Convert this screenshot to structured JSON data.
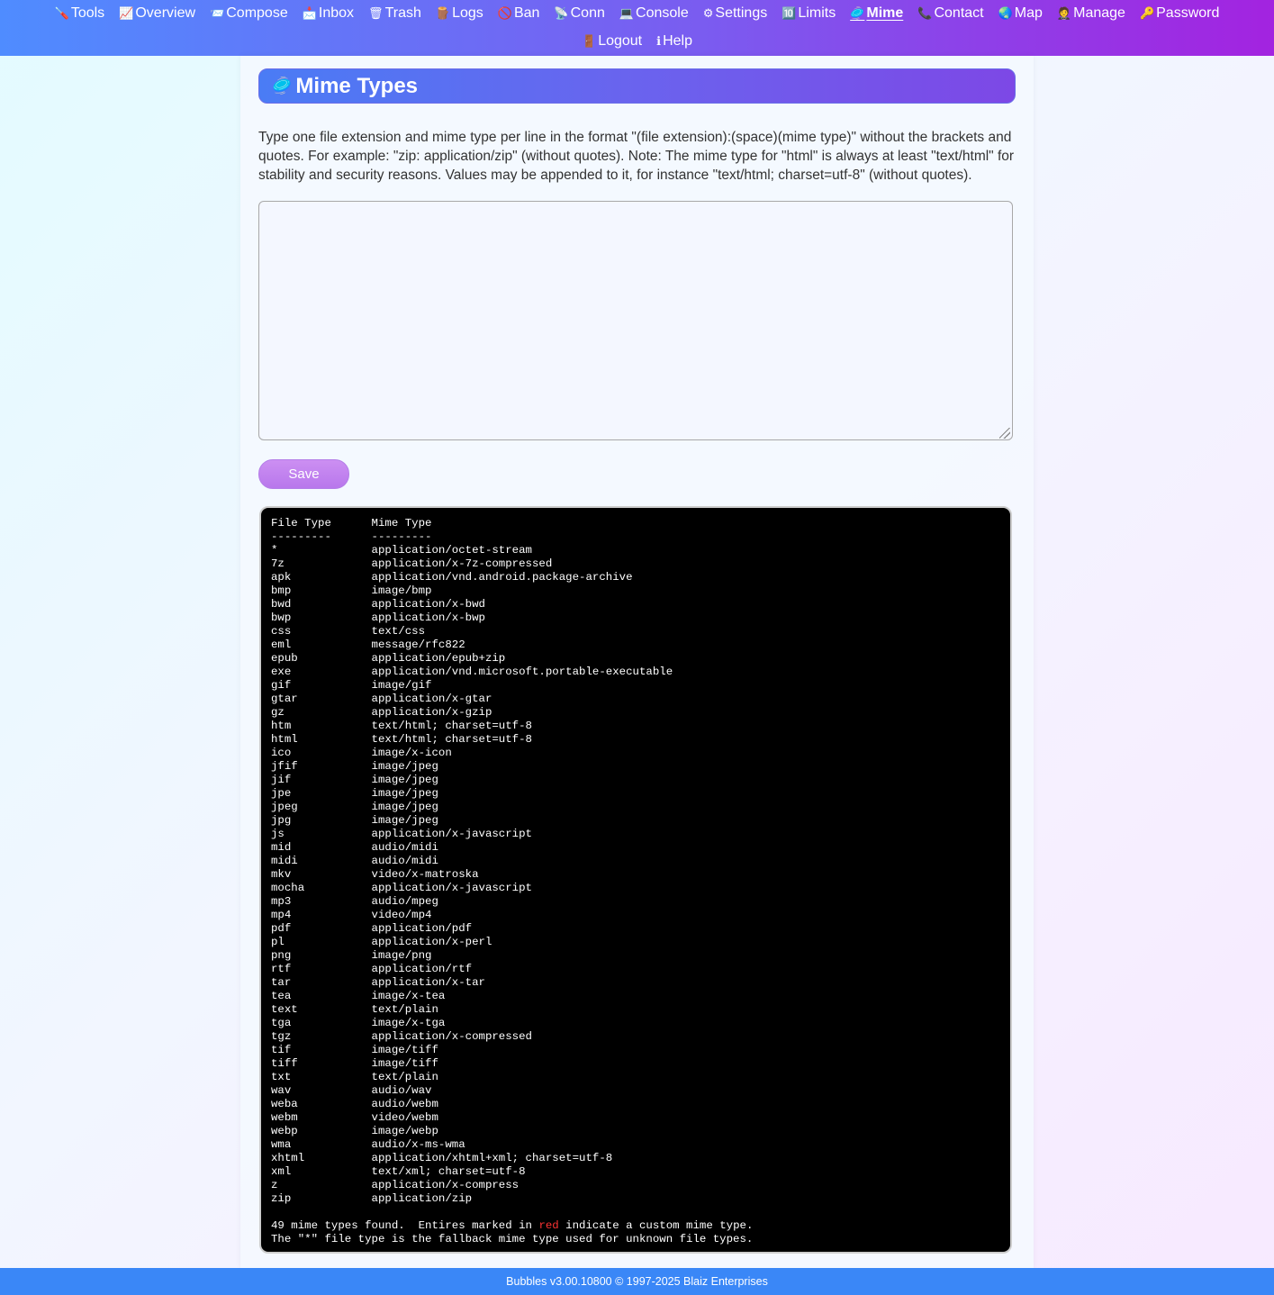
{
  "nav": {
    "row1": [
      {
        "icon": "🪛",
        "label": "Tools"
      },
      {
        "icon": "📈",
        "label": "Overview"
      },
      {
        "icon": "📨",
        "label": "Compose"
      },
      {
        "icon": "📩",
        "label": "Inbox"
      },
      {
        "icon": "🗑",
        "label": "Trash"
      },
      {
        "icon": "🪵",
        "label": "Logs"
      },
      {
        "icon": "🚫",
        "label": "Ban"
      },
      {
        "icon": "📡",
        "label": "Conn"
      },
      {
        "icon": "💻",
        "label": "Console"
      },
      {
        "icon": "⚙",
        "label": "Settings"
      },
      {
        "icon": "🔟",
        "label": "Limits"
      },
      {
        "icon": "🥏",
        "label": "Mime"
      },
      {
        "icon": "📞",
        "label": "Contact"
      },
      {
        "icon": "🌏",
        "label": "Map"
      },
      {
        "icon": "🤵",
        "label": "Manage"
      },
      {
        "icon": "🔑",
        "label": "Password"
      }
    ],
    "row2": [
      {
        "icon": "🚪",
        "label": "Logout"
      },
      {
        "icon": "ℹ",
        "label": "Help"
      }
    ],
    "active": "Mime"
  },
  "page": {
    "title_icon": "🥏",
    "title": "Mime Types",
    "instructions": "Type one file extension and mime type per line in the format \"(file extension):(space)(mime type)\" without the brackets and quotes. For example: \"zip: application/zip\" (without quotes). Note: The mime type for \"html\" is always at least \"text/html\" for stability and security reasons. Values may be appended to it, for instance \"text/html; charset=utf-8\" (without quotes).",
    "textarea_value": "",
    "save_label": "Save"
  },
  "console": {
    "header_file": "File Type",
    "header_mime": "Mime Type",
    "separator": "---------",
    "rows": [
      [
        "*",
        "application/octet-stream"
      ],
      [
        "7z",
        "application/x-7z-compressed"
      ],
      [
        "apk",
        "application/vnd.android.package-archive"
      ],
      [
        "bmp",
        "image/bmp"
      ],
      [
        "bwd",
        "application/x-bwd"
      ],
      [
        "bwp",
        "application/x-bwp"
      ],
      [
        "css",
        "text/css"
      ],
      [
        "eml",
        "message/rfc822"
      ],
      [
        "epub",
        "application/epub+zip"
      ],
      [
        "exe",
        "application/vnd.microsoft.portable-executable"
      ],
      [
        "gif",
        "image/gif"
      ],
      [
        "gtar",
        "application/x-gtar"
      ],
      [
        "gz",
        "application/x-gzip"
      ],
      [
        "htm",
        "text/html; charset=utf-8"
      ],
      [
        "html",
        "text/html; charset=utf-8"
      ],
      [
        "ico",
        "image/x-icon"
      ],
      [
        "jfif",
        "image/jpeg"
      ],
      [
        "jif",
        "image/jpeg"
      ],
      [
        "jpe",
        "image/jpeg"
      ],
      [
        "jpeg",
        "image/jpeg"
      ],
      [
        "jpg",
        "image/jpeg"
      ],
      [
        "js",
        "application/x-javascript"
      ],
      [
        "mid",
        "audio/midi"
      ],
      [
        "midi",
        "audio/midi"
      ],
      [
        "mkv",
        "video/x-matroska"
      ],
      [
        "mocha",
        "application/x-javascript"
      ],
      [
        "mp3",
        "audio/mpeg"
      ],
      [
        "mp4",
        "video/mp4"
      ],
      [
        "pdf",
        "application/pdf"
      ],
      [
        "pl",
        "application/x-perl"
      ],
      [
        "png",
        "image/png"
      ],
      [
        "rtf",
        "application/rtf"
      ],
      [
        "tar",
        "application/x-tar"
      ],
      [
        "tea",
        "image/x-tea"
      ],
      [
        "text",
        "text/plain"
      ],
      [
        "tga",
        "image/x-tga"
      ],
      [
        "tgz",
        "application/x-compressed"
      ],
      [
        "tif",
        "image/tiff"
      ],
      [
        "tiff",
        "image/tiff"
      ],
      [
        "txt",
        "text/plain"
      ],
      [
        "wav",
        "audio/wav"
      ],
      [
        "weba",
        "audio/webm"
      ],
      [
        "webm",
        "video/webm"
      ],
      [
        "webp",
        "image/webp"
      ],
      [
        "wma",
        "audio/x-ms-wma"
      ],
      [
        "xhtml",
        "application/xhtml+xml; charset=utf-8"
      ],
      [
        "xml",
        "text/xml; charset=utf-8"
      ],
      [
        "z",
        "application/x-compress"
      ],
      [
        "zip",
        "application/zip"
      ]
    ],
    "summary_before": "49 mime types found.  Entires marked in ",
    "summary_red": "red",
    "summary_after": " indicate a custom mime type.",
    "fallback_note": "The \"*\" file type is the fallback mime type used for unknown file types."
  },
  "footer": {
    "text": "Bubbles v3.00.10800 © 1997-2025 Blaiz Enterprises"
  },
  "colors": {
    "nav_gradient_start": "#4f8cff",
    "nav_gradient_end": "#a323e0",
    "footer_bg": "#3a87f7",
    "console_bg": "#000000",
    "custom_mime_red": "#ff3333"
  }
}
